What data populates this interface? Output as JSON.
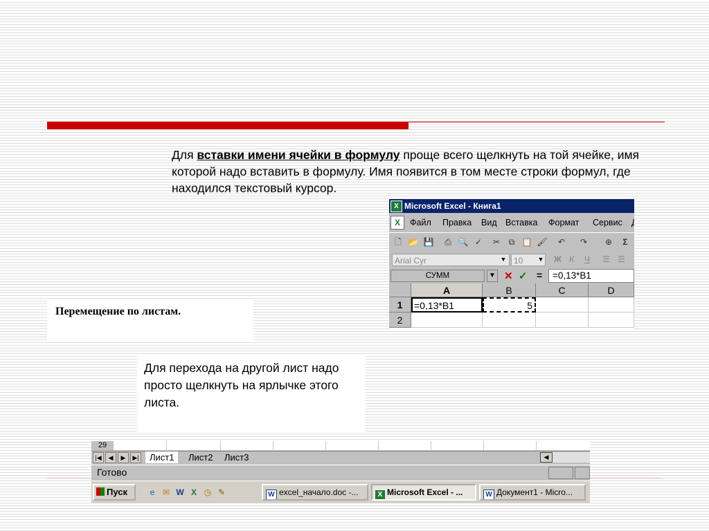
{
  "slide": {
    "paragraph1": {
      "before": "Для ",
      "highlight": "вставки имени ячейки в формулу",
      "after": " проще всего щелкнуть на той ячейке, имя которой надо вставить в формулу. Имя появится в том месте строки формул, где находился текстовый курсор."
    },
    "heading": "Перемещение по листам.",
    "paragraph2": "Для перехода на другой лист надо просто щелкнуть на ярлычке этого листа.",
    "colors": {
      "accent_bar": "#cc0000",
      "stripes": "#dcdcdc"
    }
  },
  "excel_top": {
    "title": "Microsoft Excel - Книга1",
    "menu": [
      "Файл",
      "Правка",
      "Вид",
      "Вставка",
      "Формат",
      "Сервис",
      "Д"
    ],
    "toolbar_icons": [
      "new-icon",
      "open-icon",
      "save-icon",
      "print-icon",
      "preview-icon",
      "spelling-icon",
      "cut-icon",
      "copy-icon",
      "paste-icon",
      "format-painter-icon",
      "undo-icon",
      "redo-icon",
      "hyperlink-icon",
      "autosum-icon"
    ],
    "font_name": "Arial Cyr",
    "font_size": "10",
    "format_buttons": [
      "Ж",
      "К",
      "Ч"
    ],
    "name_box": "СУММ",
    "formula_cancel": "✕",
    "formula_ok": "✓",
    "formula_eq": "=",
    "formula": "=0,13*B1",
    "columns": [
      "A",
      "B",
      "C",
      "D"
    ],
    "rows": [
      {
        "header": "1",
        "cells": [
          "=0,13*B1",
          "5",
          "",
          ""
        ]
      },
      {
        "header": "2",
        "cells": [
          "",
          "",
          "",
          ""
        ]
      }
    ]
  },
  "excel_bottom": {
    "prev_row": "29",
    "sheet_tabs": [
      "Лист1",
      "Лист2",
      "Лист3"
    ],
    "active_tab": "Лист1",
    "status": "Готово",
    "taskbar": {
      "start": "Пуск",
      "quicklaunch_icons": [
        "ie-icon",
        "outlook-icon",
        "word-icon",
        "excel-icon",
        "calendar-icon",
        "edit-icon"
      ],
      "tasks": [
        "excel_начало.doc -...",
        "Microsoft Excel - ...",
        "Документ1 - Micro..."
      ]
    }
  }
}
